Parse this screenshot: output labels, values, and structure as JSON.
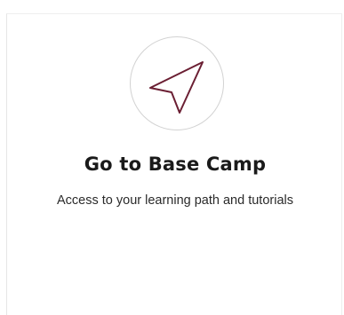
{
  "card": {
    "icon": "send-navigation-arrow-icon",
    "icon_color": "#6b1f33",
    "circle_border_color": "#d2d2d2",
    "title": "Go to Base Camp",
    "description": "Access to your learning path and tutorials"
  }
}
